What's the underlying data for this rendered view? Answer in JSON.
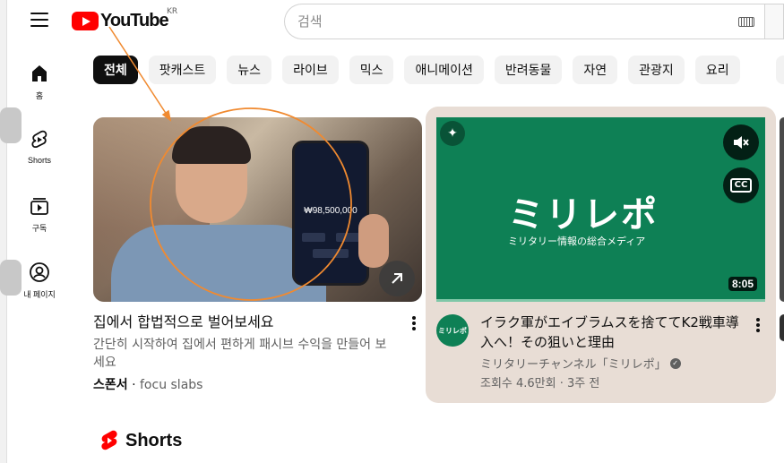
{
  "header": {
    "logo_text": "YouTube",
    "country_code": "KR",
    "search_placeholder": "검색"
  },
  "sidebar": {
    "items": [
      {
        "label": "홈",
        "icon": "home-icon"
      },
      {
        "label": "Shorts",
        "icon": "shorts-icon"
      },
      {
        "label": "구독",
        "icon": "subscriptions-icon"
      },
      {
        "label": "내 페이지",
        "icon": "profile-icon"
      }
    ]
  },
  "chips": [
    "전체",
    "팟캐스트",
    "뉴스",
    "라이브",
    "믹스",
    "애니메이션",
    "반려동물",
    "자연",
    "관광지",
    "요리"
  ],
  "ad_card": {
    "phone_amount": "₩98,500,000",
    "title": "집에서 합법적으로 벌어보세요",
    "description": "간단히 시작하여 집에서 편하게 패시브 수익을 만들어 보세요",
    "sponsor_label": "스폰서",
    "separator": "·",
    "sponsor_source": "focu slabs"
  },
  "video_card": {
    "thumbnail_logo": "ミリレポ",
    "thumbnail_subtitle": "ミリタリー情報の総合メディア",
    "duration": "8:05",
    "cc_label": "CC",
    "title": "イラク軍がエイブラムスを捨ててK2戦車導入へ！その狙いと理由",
    "channel": "ミリタリーチャンネル「ミリレポ」",
    "meta": "조회수 4.6만회 · 3주 전"
  },
  "shorts_section": {
    "title": "Shorts"
  },
  "colors": {
    "brand_red": "#ff0000",
    "highlight_card": "#e8ddd5",
    "thumbnail_green": "#0e8055",
    "annotation": "#f08a30"
  }
}
